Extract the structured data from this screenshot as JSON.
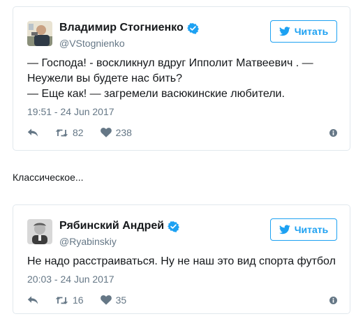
{
  "tweets": [
    {
      "author_name": "Владимир Стогниенко",
      "handle": "@VStognienko",
      "follow_label": "Читать",
      "text": "— Господа! - воскликнул вдруг Ипполит Матвеевич . — Неужели вы будете нас бить?\n— Еще как! — загремели васюкинские любители.",
      "timestamp": "19:51 - 24 Jun 2017",
      "retweets": "82",
      "likes": "238",
      "avatar_icon": "photo-avatar"
    },
    {
      "author_name": "Рябинский Андрей",
      "handle": "@Ryabinskiy",
      "follow_label": "Читать",
      "text": "Не надо расстраиваться. Ну не наш это вид спорта футбол",
      "timestamp": "20:03 - 24 Jun 2017",
      "retweets": "16",
      "likes": "35",
      "avatar_icon": "photo-avatar"
    }
  ],
  "between_text": "Классическое...",
  "colors": {
    "accent": "#1da1f2",
    "muted": "#657786",
    "border": "#e1e8ed",
    "text": "#14171a"
  },
  "icons": {
    "verified": "verified-badge-icon",
    "follow": "twitter-bird-icon",
    "reply": "reply-icon",
    "retweet": "retweet-icon",
    "like": "heart-icon",
    "info": "info-icon"
  }
}
